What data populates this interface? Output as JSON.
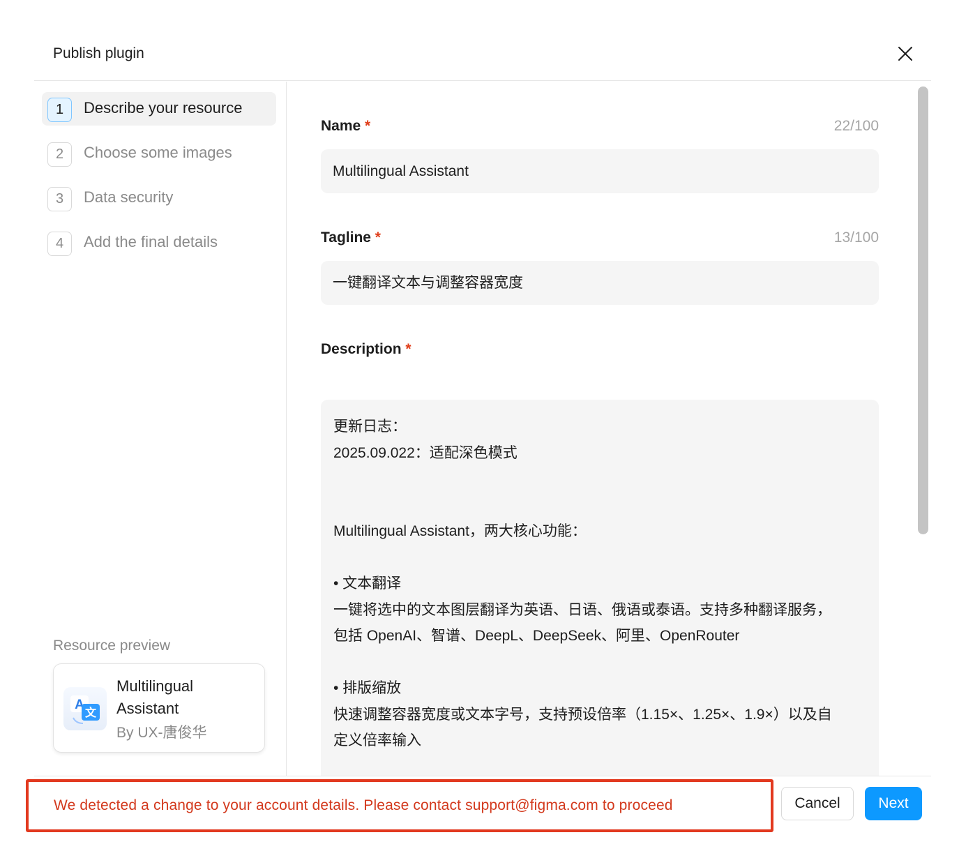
{
  "dialog": {
    "title": "Publish plugin"
  },
  "steps": [
    {
      "number": "1",
      "label": "Describe your resource",
      "active": true
    },
    {
      "number": "2",
      "label": "Choose some images",
      "active": false
    },
    {
      "number": "3",
      "label": "Data security",
      "active": false
    },
    {
      "number": "4",
      "label": "Add the final details",
      "active": false
    }
  ],
  "preview": {
    "label": "Resource preview",
    "name": "Multilingual Assistant",
    "author": "By UX-唐俊华",
    "icon": "translate-icon"
  },
  "form": {
    "name": {
      "label": "Name",
      "required_mark": "*",
      "counter": "22/100",
      "value": "Multilingual Assistant"
    },
    "tagline": {
      "label": "Tagline",
      "required_mark": "*",
      "counter": "13/100",
      "value": "一键翻译文本与调整容器宽度"
    },
    "description": {
      "label": "Description",
      "required_mark": "*",
      "lines": [
        "更新日志：",
        "2025.09.022：适配深色模式",
        "",
        "",
        "Multilingual Assistant，两大核心功能：",
        "",
        "• 文本翻译",
        "一键将选中的文本图层翻译为英语、日语、俄语或泰语。支持多种翻译服务，",
        "包括 OpenAI、智谱、DeepL、DeepSeek、阿里、OpenRouter",
        "",
        "• 排版缩放",
        "快速调整容器宽度或文本字号，支持预设倍率（1.15×、1.25×、1.9×）以及自",
        "定义倍率输入"
      ]
    }
  },
  "footer": {
    "alert": "We detected a change to your account details. Please contact support@figma.com to proceed",
    "cancel_label": "Cancel",
    "next_label": "Next"
  },
  "colors": {
    "accent": "#0d99ff",
    "alert": "#e2391f",
    "required": "#e03e1a"
  }
}
